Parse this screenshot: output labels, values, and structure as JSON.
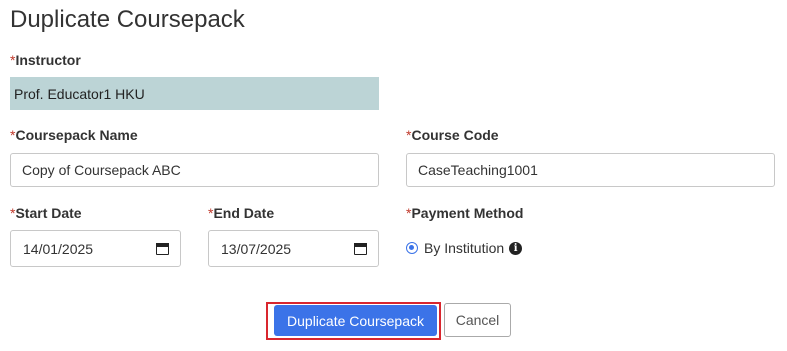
{
  "page": {
    "title": "Duplicate Coursepack"
  },
  "required_marker": "*",
  "form": {
    "instructor": {
      "label": "Instructor",
      "value": "Prof. Educator1 HKU"
    },
    "coursepack_name": {
      "label": "Coursepack Name",
      "value": "Copy of Coursepack ABC"
    },
    "course_code": {
      "label": "Course Code",
      "value": "CaseTeaching1001"
    },
    "start_date": {
      "label": "Start Date",
      "value": "14/01/2025"
    },
    "end_date": {
      "label": "End Date",
      "value": "13/07/2025"
    },
    "payment_method": {
      "label": "Payment Method",
      "option": "By Institution",
      "selected": true
    }
  },
  "actions": {
    "primary_label": "Duplicate Coursepack",
    "cancel_label": "Cancel"
  },
  "colors": {
    "accent": "#3b73e8",
    "highlight": "#d9262e",
    "readonly_bg": "#bcd4d6",
    "required": "#c0392b"
  },
  "icons": {
    "calendar": "calendar-icon",
    "info": "info-icon"
  }
}
